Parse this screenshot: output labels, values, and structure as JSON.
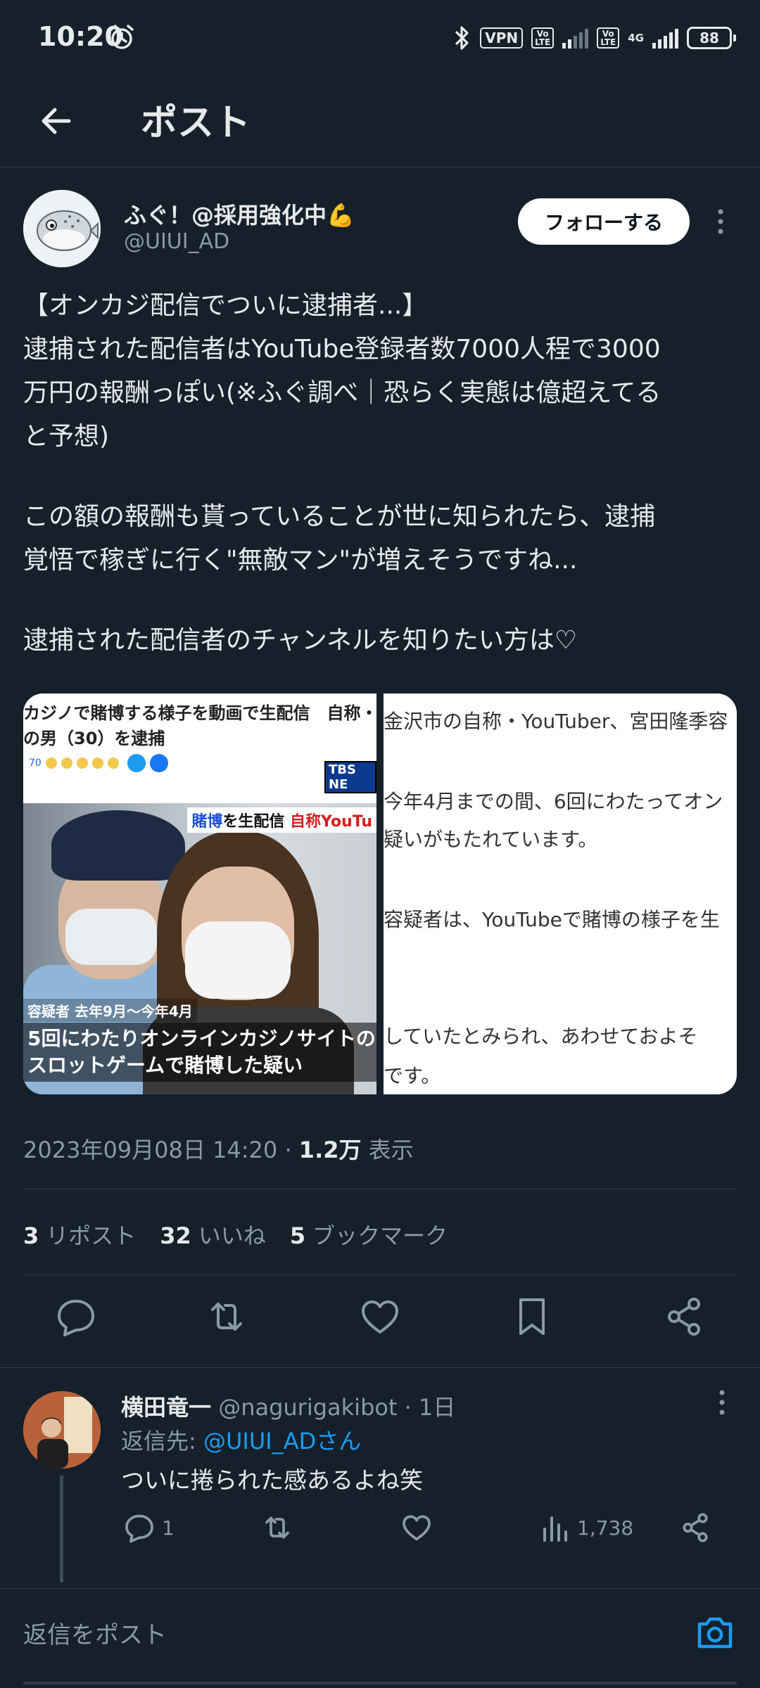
{
  "status_bar": {
    "time": "10:20",
    "vpn": "VPN",
    "volte": "Vo\nLTE",
    "net": "4G",
    "battery": "88"
  },
  "header": {
    "title": "ポスト"
  },
  "author": {
    "name": "ふぐ！@採用強化中💪",
    "handle": "@UIUI_AD",
    "follow_label": "フォローする"
  },
  "post": {
    "lines": [
      "【オンカジ配信でついに逮捕者...】",
      "逮捕された配信者はYouTube登録者数7000人程で3000",
      "万円の報酬っぽい(※ふぐ調べ｜恐らく実態は億超えてる",
      "と予想)",
      "",
      "この額の報酬も貰っていることが世に知られたら、逮捕",
      "覚悟で稼ぎに行く\"無敵マン\"が増えそうですね...",
      "",
      "逮捕された配信者のチャンネルを知りたい方は♡"
    ]
  },
  "media": {
    "left": {
      "headline_1": "カジノで賭博する様子を動画で生配信　自称・",
      "headline_2": "の男（30）を逮捕",
      "comment_count": "70",
      "tbs": "TBS NE",
      "tag_prefix": "賭博",
      "tag_mid": "を生配信",
      "tag_suffix": "自称YouTu",
      "caption_small_a": "容疑者",
      "caption_small_b": "去年9月〜今年4月",
      "caption_big_1": "5回にわたりオンラインカジノサイトの",
      "caption_big_2": "スロットゲームで賭博した疑い"
    },
    "right": {
      "lines": [
        "金沢市の自称・YouTuber、宮田隆季容",
        "今年4月までの間、6回にわたってオン",
        "疑いがもたれています。",
        "容疑者は、YouTubeで賭博の様子を生",
        "していたとみられ、あわせておよそ",
        "です。"
      ]
    }
  },
  "meta": {
    "datetime": "2023年09月08日 14:20",
    "sep": "·",
    "views": "1.2万",
    "views_label": "表示"
  },
  "stats": {
    "reposts": "3",
    "reposts_label": "リポスト",
    "likes": "32",
    "likes_label": "いいね",
    "bookmarks": "5",
    "bookmarks_label": "ブックマーク"
  },
  "reply": {
    "name": "横田竜一",
    "handle": "@nagurigakibot",
    "time": "· 1日",
    "reply_to_label": "返信先: ",
    "reply_to_handle": "@UIUI_ADさん",
    "text": "ついに捲られた感あるよね笑",
    "reply_count": "1",
    "views": "1,738"
  },
  "composer": {
    "placeholder": "返信をポスト"
  },
  "colors": {
    "background": "#15202b",
    "accent": "#1d9bf0",
    "text": "#e7e9ea",
    "muted": "#8b98a5"
  }
}
